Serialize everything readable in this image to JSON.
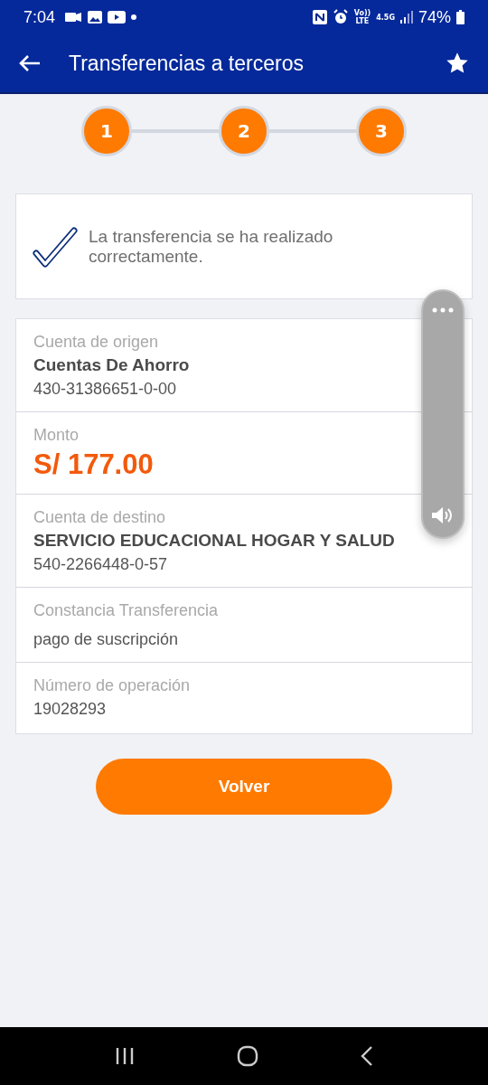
{
  "status_bar": {
    "time": "7:04",
    "network": "Vo))\nLTE",
    "data": "4.5G",
    "battery": "74%"
  },
  "app_bar": {
    "title": "Transferencias a terceros"
  },
  "steps": [
    {
      "label": "1",
      "completed": true
    },
    {
      "label": "2",
      "completed": true
    },
    {
      "label": "3",
      "completed": true
    }
  ],
  "success": {
    "message": "La transferencia se ha realizado correctamente."
  },
  "details": [
    {
      "kind": "account",
      "label": "Cuenta de origen",
      "title": "Cuentas De Ahorro",
      "value": "430-31386651-0-00"
    },
    {
      "kind": "amount",
      "label": "Monto",
      "value": "S/ 177.00"
    },
    {
      "kind": "account",
      "label": "Cuenta de destino",
      "title": "SERVICIO EDUCACIONAL HOGAR Y SALUD",
      "value": "540-2266448-0-57"
    },
    {
      "kind": "text",
      "label": "Constancia Transferencia",
      "value": "pago de suscripción"
    },
    {
      "kind": "plain",
      "label": "Número de operación",
      "value": "19028293"
    }
  ],
  "primary_button": {
    "label": "Volver"
  },
  "volume_panel": {
    "visible": true
  }
}
